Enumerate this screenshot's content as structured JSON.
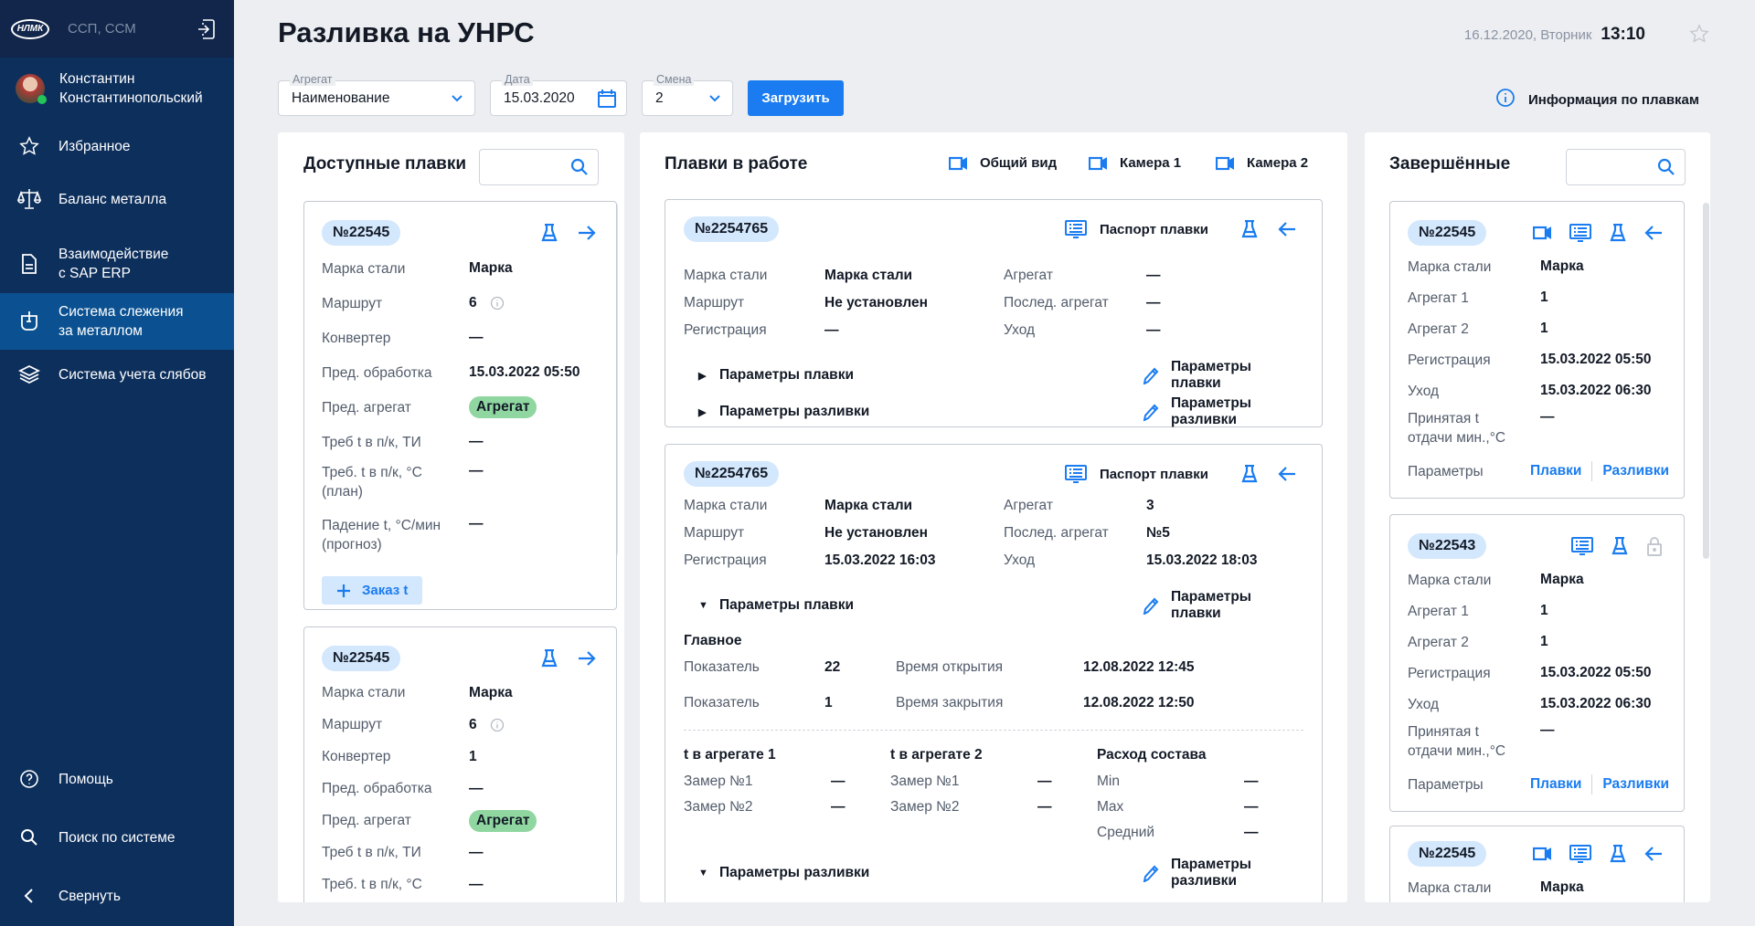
{
  "sidebar": {
    "logo": "НЛМК",
    "org": "ССП, ССМ",
    "user": "Константин\nКонстантинопольский",
    "items": [
      {
        "label": "Избранное",
        "icon": "star"
      },
      {
        "label": "Баланс металла",
        "icon": "scales"
      },
      {
        "label": "Взаимодействие\nс SAP ERP",
        "icon": "doc"
      },
      {
        "label": "Система слежения\nза металлом",
        "icon": "ladle",
        "active": true
      },
      {
        "label": "Система учета слябов",
        "icon": "layers"
      }
    ],
    "bottom": [
      {
        "label": "Помощь",
        "icon": "help"
      },
      {
        "label": "Поиск по системе",
        "icon": "search"
      },
      {
        "label": "Свернуть",
        "icon": "chev-left"
      }
    ]
  },
  "header": {
    "title": "Разливка на УНРС",
    "date": "16.12.2020, Вторник",
    "time": "13:10"
  },
  "filters": {
    "agg_label": "Агрегат",
    "agg_value": "Наименование",
    "date_label": "Дата",
    "date_value": "15.03.2020",
    "shift_label": "Смена",
    "shift_value": "2",
    "load": "Загрузить",
    "info": "Информация по плавкам"
  },
  "colors": {
    "accent": "#1a7cf0",
    "sidebar": "#0d2f5c",
    "active": "#0b5191",
    "badge": "#d3e7fd",
    "green": "#8fd6a0"
  },
  "available": {
    "title": "Доступные плавки",
    "cards": [
      {
        "num": "№22545",
        "rows": [
          {
            "l": "Марка стали",
            "v": "Марка"
          },
          {
            "l": "Маршрут",
            "v": "6",
            "info": true
          },
          {
            "l": "Конвертер",
            "v": "—"
          },
          {
            "l": "Пред. обработка",
            "v": "15.03.2022  05:50"
          },
          {
            "l": "Пред. агрегат",
            "v": "Агрегат",
            "badge": true
          },
          {
            "l": "Треб t в п/к, ТИ",
            "v": "—"
          },
          {
            "l": "Треб. t в п/к, °C\n(план)",
            "v": "—"
          },
          {
            "l": "Падение t, °C/мин\n(прогноз)",
            "v": "—"
          }
        ],
        "order": "Заказ t"
      },
      {
        "num": "№22545",
        "rows": [
          {
            "l": "Марка стали",
            "v": "Марка"
          },
          {
            "l": "Маршрут",
            "v": "6",
            "info": true
          },
          {
            "l": "Конвертер",
            "v": "1"
          },
          {
            "l": "Пред. обработка",
            "v": "—"
          },
          {
            "l": "Пред. агрегат",
            "v": "Агрегат",
            "badge": true
          },
          {
            "l": "Треб t в п/к, ТИ",
            "v": "—"
          },
          {
            "l": "Треб. t в п/к, °C",
            "v": "—"
          }
        ]
      }
    ]
  },
  "inwork": {
    "title": "Плавки в работе",
    "cameras": [
      "Общий вид",
      "Камера 1",
      "Камера 2"
    ],
    "cards": [
      {
        "num": "№2254765",
        "passport": "Паспорт плавки",
        "grid": [
          [
            "Марка стали",
            "Марка стали",
            "Агрегат",
            "—"
          ],
          [
            "Маршрут",
            "Не установлен",
            "Послед. агрегат",
            "—"
          ],
          [
            "Регистрация",
            "—",
            "Уход",
            "—"
          ]
        ],
        "params": [
          {
            "label": "Параметры плавки",
            "edit": "Параметры плавки",
            "open": false
          },
          {
            "label": "Параметры разливки",
            "edit": "Параметры разливки",
            "open": false
          }
        ]
      },
      {
        "num": "№2254765",
        "passport": "Паспорт плавки",
        "grid": [
          [
            "Марка стали",
            "Марка стали",
            "Агрегат",
            "3"
          ],
          [
            "Маршрут",
            "Не установлен",
            "Послед. агрегат",
            "№5"
          ],
          [
            "Регистрация",
            "15.03.2022  16:03",
            "Уход",
            "15.03.2022  18:03"
          ]
        ],
        "params": [
          {
            "label": "Параметры плавки",
            "edit": "Параметры плавки",
            "open": true
          },
          {
            "label": "Параметры разливки",
            "edit": "Параметры разливки",
            "open": true
          }
        ],
        "main_title": "Главное",
        "main": [
          [
            "Показатель",
            "22",
            "Время открытия",
            "12.08.2022  12:45"
          ],
          [
            "Показатель",
            "1",
            "Время закрытия",
            "12.08.2022  12:50"
          ]
        ],
        "groups": [
          {
            "h": "t в агрегате 1",
            "rows": [
              [
                "Замер №1",
                "—"
              ],
              [
                "Замер №2",
                "—"
              ]
            ]
          },
          {
            "h": "t в агрегате 2",
            "rows": [
              [
                "Замер №1",
                "—"
              ],
              [
                "Замер №2",
                "—"
              ]
            ]
          },
          {
            "h": "Расход состава",
            "rows": [
              [
                "Min",
                "—"
              ],
              [
                "Max",
                "—"
              ],
              [
                "Средний",
                "—"
              ]
            ]
          }
        ]
      }
    ]
  },
  "completed": {
    "title": "Завершённые",
    "cards": [
      {
        "num": "№22545",
        "icons": [
          "camera",
          "list",
          "flask",
          "arrow-left"
        ],
        "rows": [
          {
            "l": "Марка стали",
            "v": "Марка"
          },
          {
            "l": "Агрегат 1",
            "v": "1"
          },
          {
            "l": "Агрегат 2",
            "v": "1"
          },
          {
            "l": "Регистрация",
            "v": "15.03.2022  05:50"
          },
          {
            "l": "Уход",
            "v": "15.03.2022  06:30"
          },
          {
            "l": "Принятая t\nотдачи мин.,°C",
            "v": "—"
          }
        ],
        "params_label": "Параметры",
        "links": [
          "Плавки",
          "Разливки"
        ]
      },
      {
        "num": "№22543",
        "icons": [
          "list",
          "flask",
          "lock"
        ],
        "rows": [
          {
            "l": "Марка стали",
            "v": "Марка"
          },
          {
            "l": "Агрегат 1",
            "v": "1"
          },
          {
            "l": "Агрегат 2",
            "v": "1"
          },
          {
            "l": "Регистрация",
            "v": "15.03.2022  05:50"
          },
          {
            "l": "Уход",
            "v": "15.03.2022  06:30"
          },
          {
            "l": "Принятая t\nотдачи мин.,°C",
            "v": "—"
          }
        ],
        "params_label": "Параметры",
        "links": [
          "Плавки",
          "Разливки"
        ]
      },
      {
        "num": "№22545",
        "icons": [
          "camera",
          "list",
          "flask",
          "arrow-left"
        ],
        "rows": [
          {
            "l": "Марка стали",
            "v": "Марка"
          }
        ]
      }
    ]
  }
}
